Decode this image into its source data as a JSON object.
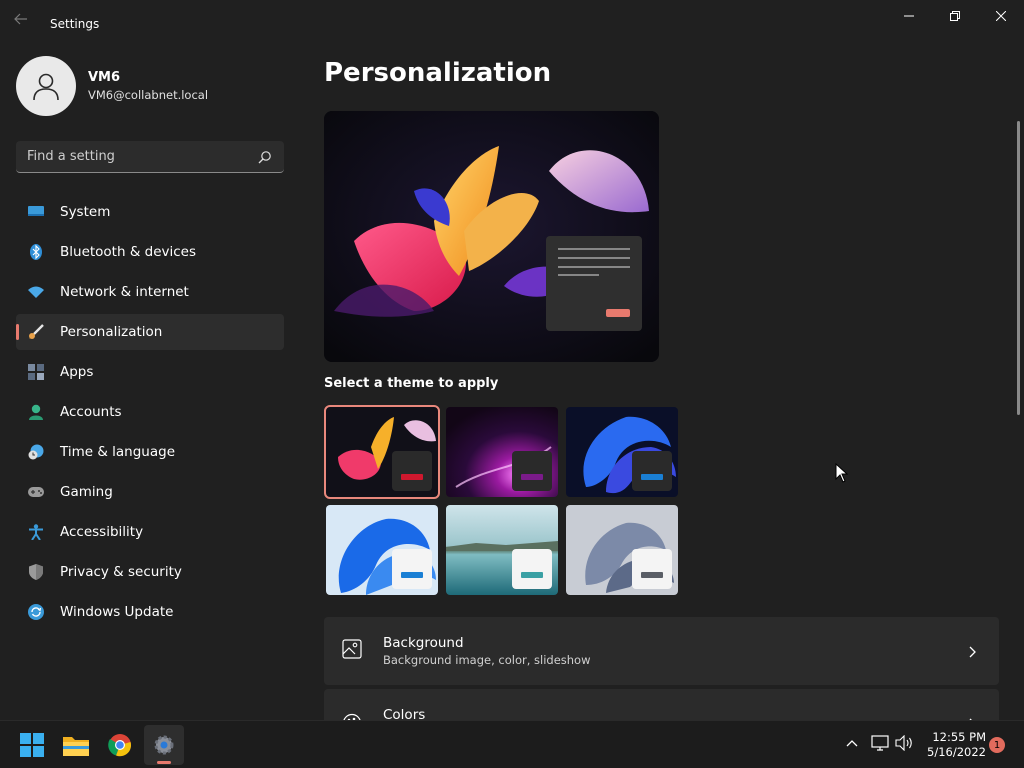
{
  "window": {
    "title": "Settings",
    "back_icon": "back-arrow-icon",
    "minimize_icon": "minimize-icon",
    "maximize_icon": "restore-icon",
    "close_icon": "close-icon"
  },
  "profile": {
    "name": "VM6",
    "email": "VM6@collabnet.local"
  },
  "search": {
    "placeholder": "Find a setting",
    "icon": "search-icon"
  },
  "nav": {
    "items": [
      {
        "label": "System",
        "icon": "system-icon",
        "color": "#3a9ad9"
      },
      {
        "label": "Bluetooth & devices",
        "icon": "bluetooth-icon",
        "color": "#2f8fd8"
      },
      {
        "label": "Network & internet",
        "icon": "wifi-icon",
        "color": "#4aa8e8"
      },
      {
        "label": "Personalization",
        "icon": "brush-icon",
        "color": "#e8a14a",
        "active": true
      },
      {
        "label": "Apps",
        "icon": "apps-icon",
        "color": "#7a8aa0"
      },
      {
        "label": "Accounts",
        "icon": "account-icon",
        "color": "#38b58a"
      },
      {
        "label": "Time & language",
        "icon": "clock-globe-icon",
        "color": "#4aa8e8"
      },
      {
        "label": "Gaming",
        "icon": "gamepad-icon",
        "color": "#9a9a9a"
      },
      {
        "label": "Accessibility",
        "icon": "accessibility-icon",
        "color": "#3a9ad9"
      },
      {
        "label": "Privacy & security",
        "icon": "shield-icon",
        "color": "#9a9a9a"
      },
      {
        "label": "Windows Update",
        "icon": "update-icon",
        "color": "#3a9ad9"
      }
    ]
  },
  "main": {
    "page_title": "Personalization",
    "theme_heading": "Select a theme to apply",
    "themes": [
      {
        "name": "theme-glow",
        "accent": "#d0182e",
        "selected": true
      },
      {
        "name": "theme-purple",
        "accent": "#7b1b8a"
      },
      {
        "name": "theme-dark-bloom",
        "accent": "#1a7fd4"
      },
      {
        "name": "theme-light-bloom",
        "accent": "#1a7fd4"
      },
      {
        "name": "theme-lake",
        "accent": "#3aa0a4"
      },
      {
        "name": "theme-captured-motion",
        "accent": "#5a5e66"
      }
    ],
    "cards": [
      {
        "title": "Background",
        "subtitle": "Background image, color, slideshow",
        "icon": "image-icon"
      },
      {
        "title": "Colors",
        "subtitle": "",
        "icon": "palette-icon"
      }
    ]
  },
  "taskbar": {
    "apps": [
      {
        "name": "start",
        "icon": "windows-logo-icon"
      },
      {
        "name": "file-explorer",
        "icon": "folder-icon"
      },
      {
        "name": "chrome",
        "icon": "chrome-icon"
      },
      {
        "name": "settings",
        "icon": "gear-icon",
        "active": true
      }
    ],
    "time": "12:55 PM",
    "date": "5/16/2022",
    "notification_count": "1"
  },
  "colors": {
    "accent": "#e87a6e",
    "background": "#202020",
    "card": "#2b2b2b"
  }
}
